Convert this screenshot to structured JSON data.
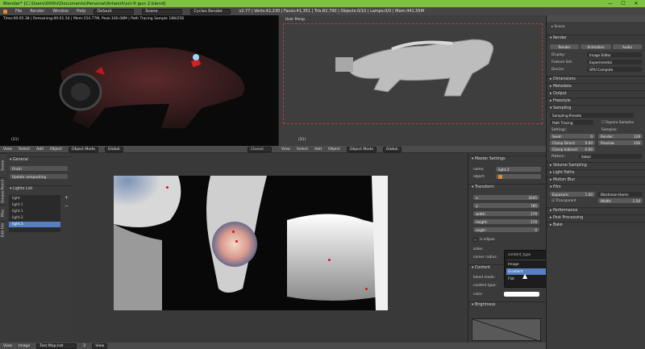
{
  "titlebar": {
    "title": "Blender* [C:\\Users\\000hi\\Documents\\Personal\\Artwork\\sci-fi gun 2.blend]",
    "min": "—",
    "max": "☐",
    "close": "✕"
  },
  "infobar": {
    "menus": [
      "File",
      "Render",
      "Window",
      "Help"
    ],
    "layout": "Default",
    "scene": "Scene",
    "engine": "Cycles Render",
    "stats": "v2.77 | Verts:42,230 | Faces:41,351 | Tris:82,790 | Objects:0/10 | Lamps:0/0 | Mem:441.55M"
  },
  "viewport_left": {
    "render_status": "Time:00:05.38 | Remaining:00:01.54 | Mem:154.77M, Peak:160.08M | Path Tracing Sample 188/256",
    "frame": "(21)",
    "menus": [
      "View",
      "Select",
      "Add",
      "Object"
    ],
    "mode": "Object Mode",
    "orientation": "Global"
  },
  "viewport_right": {
    "label": "User Persp",
    "frame": "(21)",
    "menus": [
      "View",
      "Select",
      "Add",
      "Object"
    ],
    "mode": "Object Mode",
    "orientation": "Global",
    "shading": "Closest"
  },
  "left_panel": {
    "general_header": "General",
    "finish": "Finish",
    "update": "Update compositing",
    "lights_header": "Lights List",
    "lights": [
      "light",
      "light.1",
      "light.1",
      "light.2",
      "light.3"
    ],
    "tabs": [
      "Scene",
      "Grease Pencil",
      "Misc",
      "Edit Hdr"
    ]
  },
  "master": {
    "header": "Master Settings",
    "name_label": "name:",
    "name_value": "light.3",
    "object_label": "object:",
    "transform_header": "Transform",
    "fields": [
      {
        "label": "x:",
        "value": "3245"
      },
      {
        "label": "y:",
        "value": "785"
      },
      {
        "label": "width:",
        "value": "179"
      },
      {
        "label": "height:",
        "value": "179"
      },
      {
        "label": "angle:",
        "value": "0"
      }
    ],
    "is_ellipse": "is ellipse",
    "sides": "sides:",
    "corner_radius": "corner radius:",
    "content_header": "Content",
    "blend_mode": "blend mode:",
    "content_type": "content type:",
    "content_type_value": "Flat",
    "color": "color:",
    "brightness_header": "Brightness"
  },
  "dropdown": {
    "title": "content_type",
    "options": [
      "Image",
      "Gradient",
      "Flat"
    ]
  },
  "bottom_left": {
    "menus": [
      "View",
      "Image"
    ],
    "image_name": "Test Map.hdr",
    "num": "2",
    "view": "View"
  },
  "props": {
    "scene": "Scene",
    "render_header": "Render",
    "render_btn": "Render",
    "animation_btn": "Animation",
    "audio_btn": "Audio",
    "display_label": "Display:",
    "display_value": "Image Editor",
    "feature_label": "Feature Set:",
    "feature_value": "Experimental",
    "device_label": "Device:",
    "device_value": "GPU Compute",
    "sections1": [
      "Dimensions",
      "Metadata",
      "Output",
      "Freestyle"
    ],
    "sampling_header": "Sampling",
    "sampling_presets": "Sampling Presets",
    "path_tracing": "Path Tracing",
    "square_samples": "Square Samples",
    "settings": "Settings:",
    "samples": "Samples:",
    "seed": "Seed:",
    "seed_value": "0",
    "render_label": "Render:",
    "render_value": "128",
    "clamp_direct": "Clamp Direct:",
    "clamp_direct_value": "0.00",
    "preview_label": "Preview:",
    "preview_value": "256",
    "clamp_indirect": "Clamp Indirect:",
    "clamp_indirect_value": "0.00",
    "pattern_label": "Pattern:",
    "pattern_value": "Sobol",
    "sections2": [
      "Volume Sampling",
      "Light Paths",
      "Motion Blur"
    ],
    "film_header": "Film",
    "exposure": "Exposure:",
    "exposure_value": "1.00",
    "filter_type": "Blackman-Harris",
    "transparent": "Transparent",
    "width_label": "Width:",
    "width_value": "1.50",
    "sections3": [
      "Performance",
      "Post Processing",
      "Bake"
    ]
  },
  "colors": {
    "accent": "#7ec243",
    "panel": "#2b2b2b",
    "highlight": "#5680c2"
  }
}
